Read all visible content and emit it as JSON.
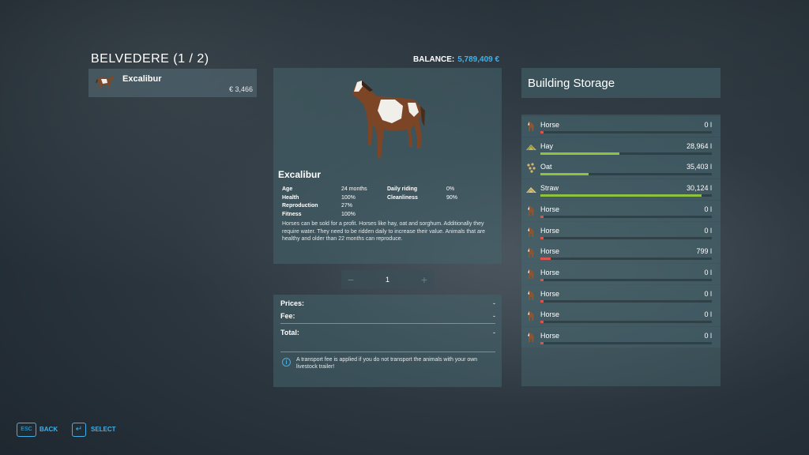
{
  "header": {
    "title": "BELVEDERE (1 / 2)",
    "balance_label": "BALANCE:",
    "balance_value": "5,789,409 €"
  },
  "animal_list": [
    {
      "name": "Excalibur",
      "price": "€ 3,466"
    }
  ],
  "detail": {
    "name": "Excalibur",
    "stats_left": [
      {
        "label": "Age",
        "value": "24 months"
      },
      {
        "label": "Health",
        "value": "100%"
      },
      {
        "label": "Reproduction",
        "value": "27%"
      },
      {
        "label": "Fitness",
        "value": "100%"
      }
    ],
    "stats_right": [
      {
        "label": "Daily riding",
        "value": "0%"
      },
      {
        "label": "Cleanliness",
        "value": "90%"
      }
    ],
    "description": "Horses can be sold for a profit. Horses like hay, oat and sorghum. Additionally they require water. They need to be ridden daily to increase their value. Animals that are healthy and older than 22 months can reproduce."
  },
  "quantity": {
    "minus": "−",
    "value": "1",
    "plus": "+"
  },
  "prices": {
    "prices_label": "Prices:",
    "prices_value": "-",
    "fee_label": "Fee:",
    "fee_value": "-",
    "total_label": "Total:",
    "total_value": "-",
    "info_text": "A transport fee is applied if you do not transport the animals with your own livestock trailer!"
  },
  "storage": {
    "title": "Building Storage",
    "items": [
      {
        "name": "Horse",
        "value": "0 l",
        "icon": "horse-icon",
        "fill": 0.0,
        "color": "#d9534f"
      },
      {
        "name": "Hay",
        "value": "28,964 l",
        "icon": "hay-icon",
        "fill": 0.46,
        "color": "#8fc33f"
      },
      {
        "name": "Oat",
        "value": "35,403 l",
        "icon": "oat-icon",
        "fill": 0.28,
        "color": "#8fc33f"
      },
      {
        "name": "Straw",
        "value": "30,124 l",
        "icon": "straw-icon",
        "fill": 0.94,
        "color": "#8fc33f"
      },
      {
        "name": "Horse",
        "value": "0 l",
        "icon": "horse-icon",
        "fill": 0.0,
        "color": "#d9534f"
      },
      {
        "name": "Horse",
        "value": "0 l",
        "icon": "horse-icon",
        "fill": 0.0,
        "color": "#d9534f"
      },
      {
        "name": "Horse",
        "value": "799 l",
        "icon": "horse-icon",
        "fill": 0.06,
        "color": "#d9534f"
      },
      {
        "name": "Horse",
        "value": "0 l",
        "icon": "horse-icon",
        "fill": 0.0,
        "color": "#d9534f"
      },
      {
        "name": "Horse",
        "value": "0 l",
        "icon": "horse-icon",
        "fill": 0.0,
        "color": "#d9534f"
      },
      {
        "name": "Horse",
        "value": "0 l",
        "icon": "horse-icon",
        "fill": 0.0,
        "color": "#d9534f"
      },
      {
        "name": "Horse",
        "value": "0 l",
        "icon": "horse-icon",
        "fill": 0.0,
        "color": "#d9534f"
      }
    ]
  },
  "footer": {
    "back_key": "ESC",
    "back_label": "BACK",
    "select_key": "↵",
    "select_label": "SELECT"
  },
  "colors": {
    "accent": "#3fb1e8",
    "good": "#8fc33f",
    "low": "#d9534f"
  }
}
